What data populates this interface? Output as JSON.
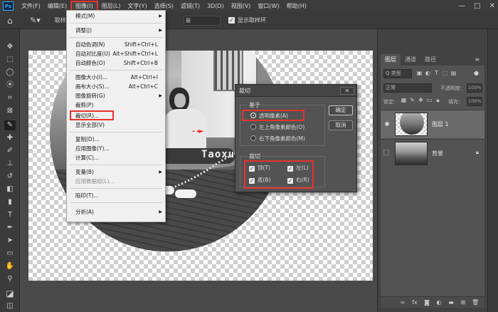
{
  "app": {
    "logo": "Ps"
  },
  "menubar": {
    "items": [
      "文件(F)",
      "编辑(E)",
      "图像(I)",
      "图层(L)",
      "文字(Y)",
      "选择(S)",
      "滤镜(T)",
      "3D(D)",
      "视图(V)",
      "窗口(W)",
      "帮助(H)"
    ],
    "active_index": 2,
    "window_controls": [
      "—",
      "□",
      "✕"
    ]
  },
  "options_bar": {
    "sample_label": "取样大",
    "sample_field_value": "层",
    "show_sampling_ring": "显示取样环"
  },
  "image_menu": {
    "items": [
      {
        "label": "模式(M)",
        "shortcut": "",
        "submenu": true,
        "disabled": false
      },
      {
        "label": "调整(J)",
        "shortcut": "",
        "submenu": true,
        "disabled": false
      },
      {
        "label": "自动色调(N)",
        "shortcut": "Shift+Ctrl+L",
        "submenu": false,
        "disabled": false
      },
      {
        "label": "自动对比度(U)",
        "shortcut": "Alt+Shift+Ctrl+L",
        "submenu": false,
        "disabled": false
      },
      {
        "label": "自动颜色(O)",
        "shortcut": "Shift+Ctrl+B",
        "submenu": false,
        "disabled": false
      },
      {
        "label": "图像大小(I)...",
        "shortcut": "Alt+Ctrl+I",
        "submenu": false,
        "disabled": false
      },
      {
        "label": "画布大小(S)...",
        "shortcut": "Alt+Ctrl+C",
        "submenu": false,
        "disabled": false
      },
      {
        "label": "图像旋转(G)",
        "shortcut": "",
        "submenu": true,
        "disabled": false
      },
      {
        "label": "裁剪(P)",
        "shortcut": "",
        "submenu": false,
        "disabled": false
      },
      {
        "label": "裁切(R)...",
        "shortcut": "",
        "submenu": false,
        "disabled": false
      },
      {
        "label": "显示全部(V)",
        "shortcut": "",
        "submenu": false,
        "disabled": false
      },
      {
        "label": "复制(D)...",
        "shortcut": "",
        "submenu": false,
        "disabled": false
      },
      {
        "label": "应用图像(Y)...",
        "shortcut": "",
        "submenu": false,
        "disabled": false
      },
      {
        "label": "计算(C)...",
        "shortcut": "",
        "submenu": false,
        "disabled": false
      },
      {
        "label": "变量(B)",
        "shortcut": "",
        "submenu": true,
        "disabled": false
      },
      {
        "label": "应用数据组(L)...",
        "shortcut": "",
        "submenu": false,
        "disabled": true
      },
      {
        "label": "陷印(T)...",
        "shortcut": "",
        "submenu": false,
        "disabled": false
      },
      {
        "label": "分析(A)",
        "shortcut": "",
        "submenu": true,
        "disabled": false
      }
    ]
  },
  "watermark": "Taoxuemei.com",
  "crop_dialog": {
    "title": "裁切",
    "close": "✕",
    "based_on_legend": "基于",
    "options": [
      {
        "label": "透明像素(A)",
        "selected": true
      },
      {
        "label": "左上角像素颜色(O)",
        "selected": false
      },
      {
        "label": "右下角像素颜色(M)",
        "selected": false
      }
    ],
    "trim_legend": "裁切",
    "checks": [
      {
        "label": "顶(T)",
        "checked": true
      },
      {
        "label": "左(L)",
        "checked": true
      },
      {
        "label": "底(B)",
        "checked": true
      },
      {
        "label": "右(R)",
        "checked": true
      }
    ],
    "ok": "确定",
    "cancel": "取消"
  },
  "layers_panel": {
    "tabs": [
      "图层",
      "通道",
      "路径"
    ],
    "active_tab": 0,
    "kind_filter": "Q 类型",
    "blend_mode": "正常",
    "opacity_label": "不透明度:",
    "opacity_value": "100%",
    "lock_label": "锁定:",
    "fill_label": "填充:",
    "fill_value": "100%",
    "layers": [
      {
        "name": "图层 1",
        "selected": true,
        "visible": true,
        "locked": false
      },
      {
        "name": "背景",
        "selected": false,
        "visible": false,
        "locked": true
      }
    ]
  },
  "colors": {
    "highlight": "#e8322e",
    "app_bg": "#535353"
  }
}
